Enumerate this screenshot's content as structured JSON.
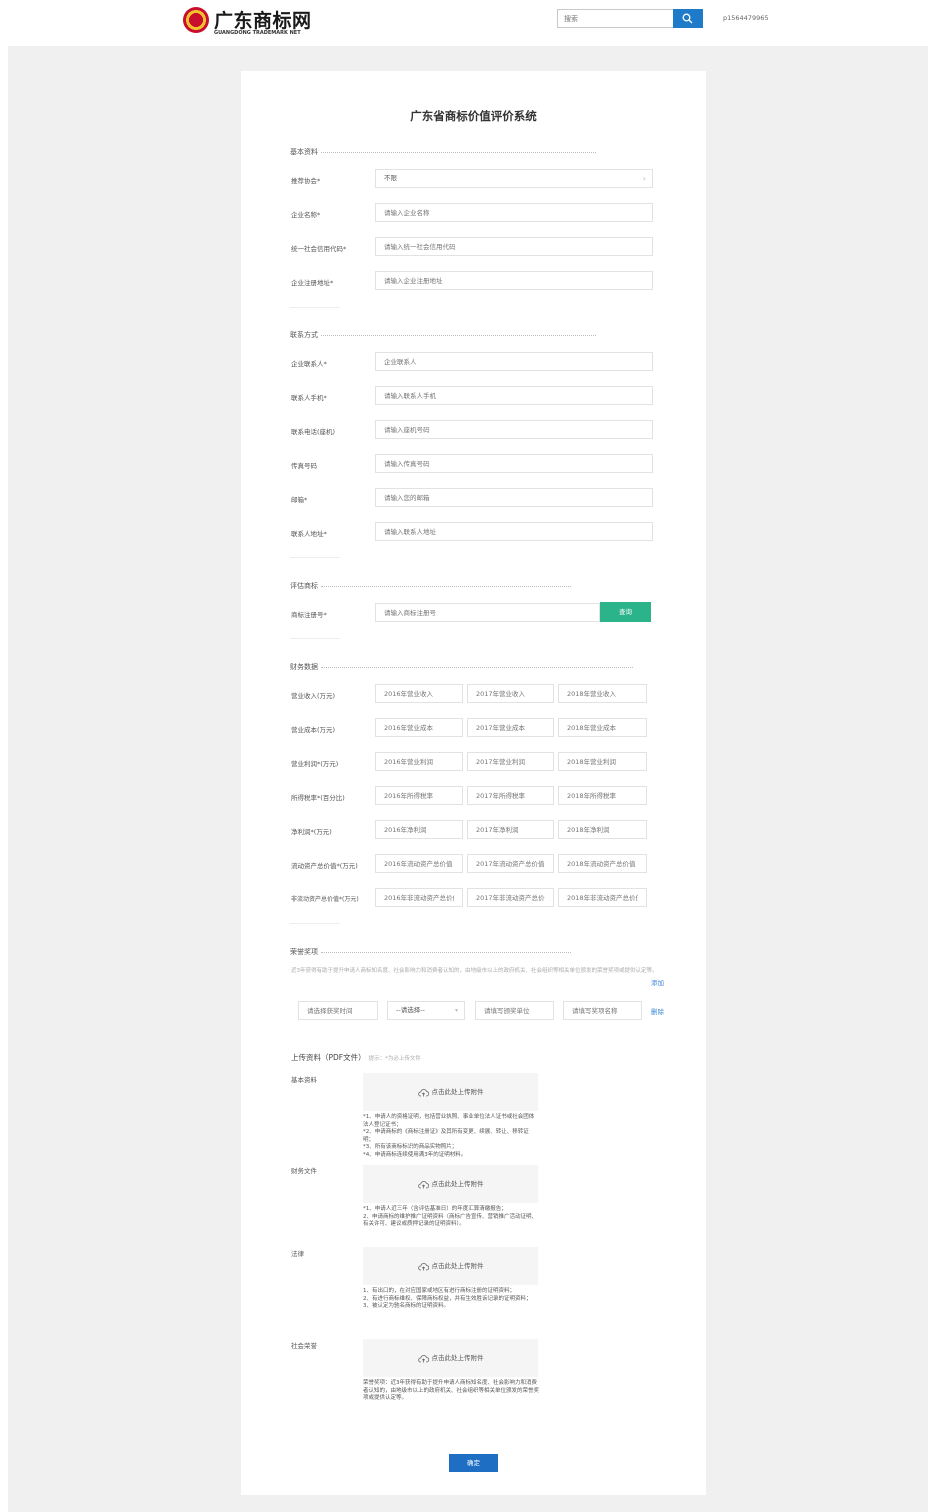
{
  "header": {
    "logo_cn": "广东商标网",
    "logo_en": "GUANGDONG TRADEMARK NET",
    "search_placeholder": "搜索",
    "user_id": "p1564479965"
  },
  "page_title": "广东省商标价值评价系统",
  "sections": {
    "basic": "基本资料",
    "contact": "联系方式",
    "trademark": "评估商标",
    "finance": "财务数据",
    "honors": "荣誉奖项"
  },
  "basic": {
    "recommend_label": "推荐协会*",
    "recommend_value": "不限",
    "company_label": "企业名称*",
    "company_ph": "请输入企业名称",
    "credit_label": "统一社会信用代码*",
    "credit_ph": "请输入统一社会信用代码",
    "address_label": "企业注册地址*",
    "address_ph": "请输入企业注册地址"
  },
  "contact": {
    "person_label": "企业联系人*",
    "person_ph": "企业联系人",
    "mobile_label": "联系人手机*",
    "mobile_ph": "请输入联系人手机",
    "phone_label": "联系电话(座机)",
    "phone_ph": "请输入座机号码",
    "fax_label": "传真号码",
    "fax_ph": "请输入传真号码",
    "email_label": "邮箱*",
    "email_ph": "请输入您的邮箱",
    "addr_label": "联系人地址*",
    "addr_ph": "请输入联系人地址"
  },
  "trademark": {
    "reg_label": "商标注册号*",
    "reg_ph": "请输入商标注册号",
    "query_btn": "查询"
  },
  "finance": {
    "rows": [
      {
        "label": "营业收入(万元)",
        "c1": "2016年营业收入",
        "c2": "2017年营业收入",
        "c3": "2018年营业收入"
      },
      {
        "label": "营业成本(万元)",
        "c1": "2016年营业成本",
        "c2": "2017年营业成本",
        "c3": "2018年营业成本"
      },
      {
        "label": "营业利润*(万元)",
        "c1": "2016年营业利润",
        "c2": "2017年营业利润",
        "c3": "2018年营业利润"
      },
      {
        "label": "所得税率*(百分比)",
        "c1": "2016年所得税率",
        "c2": "2017年所得税率",
        "c3": "2018年所得税率"
      },
      {
        "label": "净利润*(万元)",
        "c1": "2016年净利润",
        "c2": "2017年净利润",
        "c3": "2018年净利润"
      },
      {
        "label": "流动资产总价值*(万元)",
        "c1": "2016年流动资产总价值",
        "c2": "2017年流动资产总价值",
        "c3": "2018年流动资产总价值"
      },
      {
        "label": "非流动资产总价值*(万元)",
        "c1": "2016年非流动资产总价值",
        "c2": "2017年非流动资产总价值",
        "c3": "2018年非流动资产总价值"
      }
    ]
  },
  "honors": {
    "note": "近3年获得有助于提升申请人商标知名度、社会影响力和消费者认知的，由地级市以上的政府机关、社会组织等相关单位颁发的荣誉奖项或提供认定等。",
    "add_link": "添加",
    "time_ph": "请选择获奖时间",
    "select_value": "--请选择--",
    "unit_ph": "请填写颁奖单位",
    "name_ph": "请填写奖项名称",
    "delete_link": "删除"
  },
  "upload": {
    "title": "上传资料（PDF文件）",
    "hint": "提示：*为必上传文件",
    "button_label": "点击此处上传附件",
    "groups": [
      {
        "label": "基本资料",
        "lines": [
          "*1、申请人的资格证明，包括营业执照、事业单位法人证书或社会团体法人登记证书；",
          "*2、申请商标的《商标注册证》及其所有变更、续展、转让、移转证明；",
          "*3、所有该商标标识的商品实物照片；",
          "*4、申请商标连续使用满3年的证明材料。"
        ]
      },
      {
        "label": "财务文件",
        "lines": [
          "*1、申请人近三年（含评估基准日）的年度汇算清缴报告；",
          "2、申请商标的维护推广证明资料（商标广告宣传、营销推广活动证明、有关许可、建议或质押记录的证明资料）。"
        ]
      },
      {
        "label": "法律",
        "lines": [
          "1、有出口的，在对应国家或地区有进行商标注册的证明资料；",
          "2、有进行商标维权、保障商标权益，并有生效胜诉记录的证明资料；",
          "3、被认定为驰名商标的证明资料。"
        ]
      },
      {
        "label": "社会荣誉",
        "lines": [
          "荣誉奖项：近3年获得有助于提升申请人商标知名度、社会影响力和消费者认知的，由地级市以上的政府机关、社会组织等相关单位颁发的荣誉奖项或提供认定等。"
        ]
      }
    ]
  },
  "confirm_btn": "确定"
}
